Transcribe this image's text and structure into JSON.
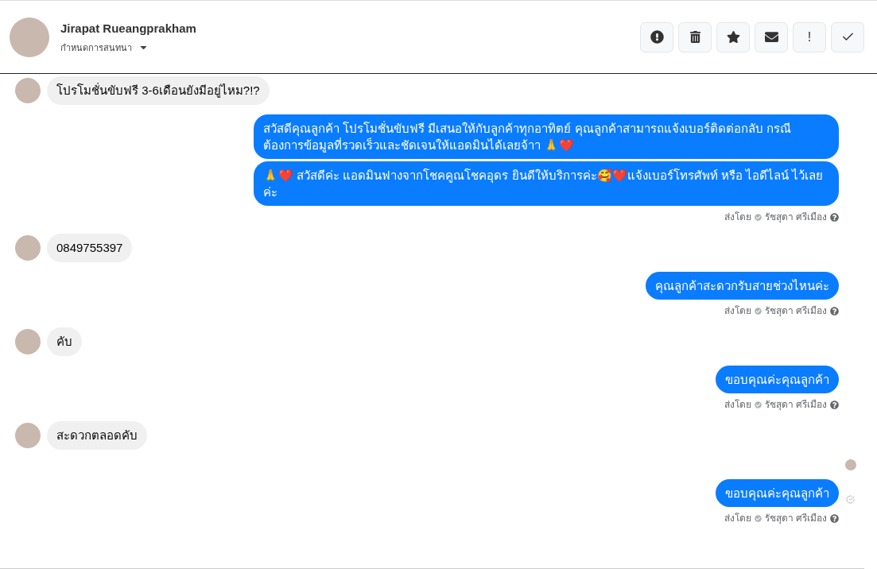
{
  "header": {
    "name": "Jirapat Rueangprakham",
    "subtitle": "กำหนดการสนทนา",
    "actions": [
      {
        "kind": "alert"
      },
      {
        "kind": "trash"
      },
      {
        "kind": "star"
      },
      {
        "kind": "mail"
      },
      {
        "kind": "exclaim",
        "label": "!"
      },
      {
        "kind": "check"
      }
    ]
  },
  "groups": [
    {
      "kind": "incoming",
      "seen": false,
      "messages": [
        {
          "text": "โปรโมชั่นขับฟรี 3-6เดือนยังมีอยู่ไหม?!?",
          "delivered": false
        }
      ]
    },
    {
      "kind": "outgoing",
      "seen": false,
      "messages": [
        {
          "text": "สวัสดีคุณลูกค้า โปรโมชั่นขับฟรี มีเสนอให้กับลูกค้าทุกอาทิตย์ คุณลูกค้าสามารถแจ้งเบอร์ติดต่อกลับ กรณีต้องการข้อมูลที่รวดเร็วและชัดเจนให้แอดมินได้เลยจ้าา 🙏❤️",
          "delivered": false
        },
        {
          "text": "🙏❤️ สวัสดีค่ะ แอดมินฟางจากโชคคูณโชคอุดร ยินดีให้บริการค่ะ🥰❤️แจ้งเบอร์โทรศัพท์ หรือ ไอดีไลน์  ไว้เลยค่ะ",
          "delivered": false
        }
      ],
      "sent_by": "ส่งโดย",
      "agent": "รัชสุดา ศรีเมือง"
    },
    {
      "kind": "incoming",
      "seen": false,
      "messages": [
        {
          "text": "0849755397",
          "delivered": false
        }
      ]
    },
    {
      "kind": "outgoing",
      "seen": false,
      "messages": [
        {
          "text": "คุณลูกค้าสะดวกรับสายช่วงไหนค่ะ",
          "delivered": false
        }
      ],
      "sent_by": "ส่งโดย",
      "agent": "รัชสุดา ศรีเมือง"
    },
    {
      "kind": "incoming",
      "seen": false,
      "messages": [
        {
          "text": "คับ",
          "delivered": false
        }
      ]
    },
    {
      "kind": "outgoing",
      "seen": false,
      "messages": [
        {
          "text": "ขอบคุณค่ะคุณลูกค้า",
          "delivered": false
        }
      ],
      "sent_by": "ส่งโดย",
      "agent": "รัชสุดา ศรีเมือง"
    },
    {
      "kind": "incoming",
      "seen": false,
      "messages": [
        {
          "text": "สะดวกตลอดคับ",
          "delivered": false
        }
      ]
    },
    {
      "kind": "outgoing",
      "seen": true,
      "messages": [
        {
          "text": "ขอบคุณค่ะคุณลูกค้า",
          "delivered": true
        }
      ],
      "sent_by": "ส่งโดย",
      "agent": "รัชสุดา ศรีเมือง"
    }
  ]
}
